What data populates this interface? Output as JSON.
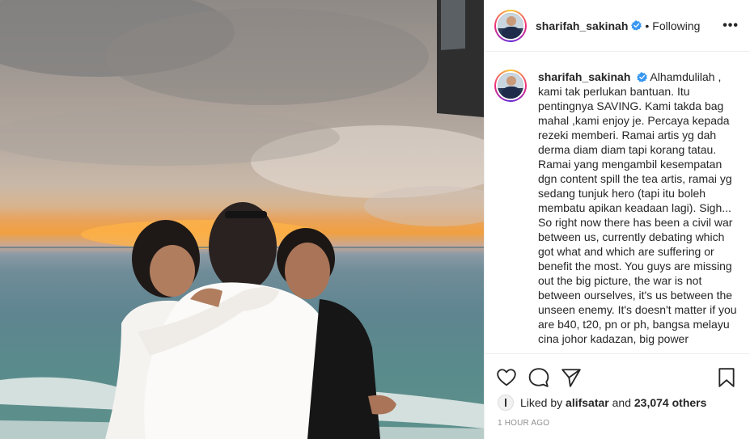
{
  "post": {
    "username": "sharifah_sakinah",
    "follow_status": "Following",
    "more_label": "•••",
    "dot": "•"
  },
  "caption": {
    "username": "sharifah_sakinah",
    "text": "Alhamdulilah , kami tak perlukan bantuan. Itu pentingnya SAVING. Kami takda bag mahal ,kami enjoy je. Percaya kepada rezeki memberi. Ramai artis yg dah derma diam diam tapi korang tatau. Ramai yang mengambil kesempatan dgn content spill the tea artis, ramai yg sedang tunjuk hero (tapi itu boleh membatu apikan keadaan lagi). Sigh... So right now there has been a civil war between us, currently debating which got what and which are suffering or benefit the most. You guys are missing out the big picture, the war is not between ourselves, it's us between the unseen enemy. It's doesn't matter if you are b40, t20, pn or ph, bangsa melayu cina johor kadazan, big power"
  },
  "likes": {
    "prefix": "Liked by",
    "user": "alifsatar",
    "middle": "and",
    "count": "23,074 others"
  },
  "timestamp": "1 HOUR AGO",
  "icons": {
    "verified": "verified-badge-icon",
    "like": "heart-icon",
    "comment": "comment-icon",
    "share": "share-icon",
    "save": "bookmark-icon"
  },
  "colors": {
    "verified": "#3897f0",
    "text": "#262626",
    "muted": "#8e8e8e"
  }
}
